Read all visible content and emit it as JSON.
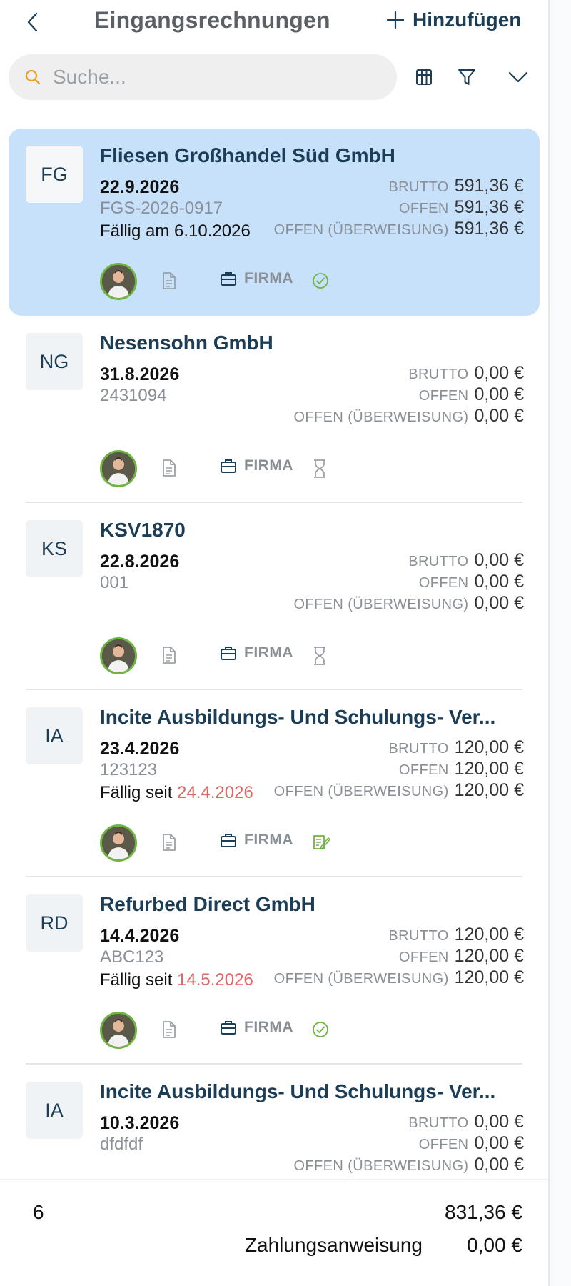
{
  "header": {
    "title": "Eingangsrechnungen",
    "add_label": "Hinzufügen"
  },
  "search": {
    "placeholder": "Suche..."
  },
  "labels": {
    "brutto": "BRUTTO",
    "offen": "OFFEN",
    "offen_ueberweisung": "OFFEN (ÜBERWEISUNG)",
    "firma": "FIRMA"
  },
  "invoices": [
    {
      "initials": "FG",
      "vendor": "Fliesen Großhandel Süd GmbH",
      "date": "22.9.2026",
      "number": "FGS-2026-0917",
      "due_prefix": "Fällig am",
      "due_date": "6.10.2026",
      "due_overdue": false,
      "brutto": "591,36 €",
      "offen": "591,36 €",
      "offen_ueberweisung": "591,36 €",
      "status_icon": "check-circle-icon",
      "selected": true
    },
    {
      "initials": "NG",
      "vendor": "Nesensohn GmbH",
      "date": "31.8.2026",
      "number": "2431094",
      "due_prefix": "",
      "due_date": "",
      "due_overdue": false,
      "brutto": "0,00 €",
      "offen": "0,00 €",
      "offen_ueberweisung": "0,00 €",
      "status_icon": "hourglass-icon",
      "selected": false
    },
    {
      "initials": "KS",
      "vendor": "KSV1870",
      "date": "22.8.2026",
      "number": "001",
      "due_prefix": "",
      "due_date": "",
      "due_overdue": false,
      "brutto": "0,00 €",
      "offen": "0,00 €",
      "offen_ueberweisung": "0,00 €",
      "status_icon": "hourglass-icon",
      "selected": false
    },
    {
      "initials": "IA",
      "vendor": "Incite Ausbildungs- Und Schulungs- Ver...",
      "date": "23.4.2026",
      "number": "123123",
      "due_prefix": "Fällig seit",
      "due_date": "24.4.2026",
      "due_overdue": true,
      "brutto": "120,00 €",
      "offen": "120,00 €",
      "offen_ueberweisung": "120,00 €",
      "status_icon": "edit-document-icon",
      "selected": false
    },
    {
      "initials": "RD",
      "vendor": "Refurbed Direct GmbH",
      "date": "14.4.2026",
      "number": "ABC123",
      "due_prefix": "Fällig seit",
      "due_date": "14.5.2026",
      "due_overdue": true,
      "brutto": "120,00 €",
      "offen": "120,00 €",
      "offen_ueberweisung": "120,00 €",
      "status_icon": "check-circle-icon",
      "selected": false
    },
    {
      "initials": "IA",
      "vendor": "Incite Ausbildungs- Und Schulungs- Ver...",
      "date": "10.3.2026",
      "number": "dfdfdf",
      "due_prefix": "",
      "due_date": "",
      "due_overdue": false,
      "brutto": "0,00 €",
      "offen": "0,00 €",
      "offen_ueberweisung": "0,00 €",
      "status_icon": "check-circle-icon",
      "selected": false
    }
  ],
  "footer": {
    "count": "6",
    "total": "831,36 €",
    "zahlung_label": "Zahlungsanweisung",
    "zahlung_value": "0,00 €"
  },
  "colors": {
    "accent": "#1b3d55",
    "selected_bg": "#c7e1fb",
    "overdue": "#e06565",
    "success": "#6fb542",
    "search_icon": "#e8a020"
  }
}
